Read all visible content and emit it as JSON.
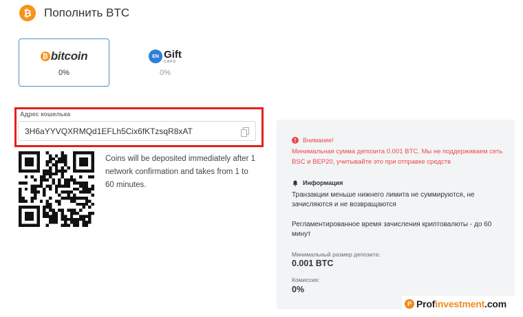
{
  "header": {
    "title": "Пополнить BTC",
    "icon": "btc-coin-icon",
    "icon_glyph": "₿"
  },
  "methods": [
    {
      "name": "bitcoin",
      "logo_glyph": "₿",
      "logo_text": "bitcoin",
      "percent": "0%",
      "active": true
    },
    {
      "name": "gift-card",
      "logo_glyph": "EN",
      "logo_text": "Gift",
      "logo_sub": "CARD",
      "percent": "0%",
      "active": false
    }
  ],
  "wallet": {
    "label": "Адрес кошелька",
    "address": "3H6aYYVQXRMQd1EFLh5Cix6fKTzsqR8xAT",
    "copy_icon": "copy-icon",
    "highlight_color": "#e1211b"
  },
  "deposit_note": "Coins will be deposited immediately after 1 network confirmation and takes from 1 to 60 minutes.",
  "info_panel": {
    "warning_title": "Внимание!",
    "warning_text": "Минимальная сумма депозита 0.001 BTC. Мы не поддерживаем сеть BSC и BEP20, учитывайте это при отправке средств",
    "warning_color": "#e84a4a",
    "info_title": "Информация",
    "info_text_1": "Транзакции меньше нижнего лимита не суммируются, не зачисляются и не возвращаются",
    "info_text_2": "Регламентированное время зачисления криптовалюты - до 60 минут",
    "min_deposit_label": "Минимальный размер депозита:",
    "min_deposit_value": "0.001 BTC",
    "fee_label": "Комиссия:",
    "fee_value": "0%"
  },
  "watermark": {
    "prefix": "Prof",
    "accent": "investment",
    "suffix": ".com"
  },
  "colors": {
    "bitcoin_orange": "#f7931a",
    "active_border": "#4a90c8",
    "panel_bg": "#f3f4f6"
  }
}
